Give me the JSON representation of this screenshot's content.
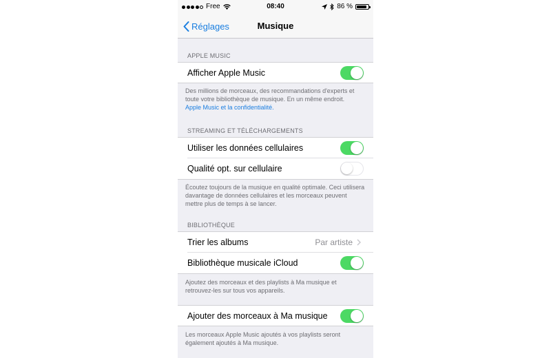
{
  "status_bar": {
    "carrier": "Free",
    "time": "08:40",
    "battery_text": "86 %",
    "battery_level": 0.86
  },
  "nav": {
    "back_label": "Réglages",
    "title": "Musique"
  },
  "sections": {
    "apple_music": {
      "header": "APPLE MUSIC",
      "row_label": "Afficher Apple Music",
      "footer_text": "Des millions de morceaux, des recommandations d'experts et toute votre bibliothèque de musique. En un même endroit.",
      "footer_link": "Apple Music et la confidentialité."
    },
    "streaming": {
      "header": "STREAMING ET TÉLÉCHARGEMENTS",
      "row1_label": "Utiliser les données cellulaires",
      "row2_label": "Qualité opt. sur cellulaire",
      "footer_text": "Écoutez toujours de la musique en qualité optimale. Ceci utilisera davantage de données cellulaires et les morceaux peuvent mettre plus de temps à se lancer."
    },
    "library": {
      "header": "BIBLIOTHÈQUE",
      "sort_label": "Trier les albums",
      "sort_value": "Par artiste",
      "icloud_label": "Bibliothèque musicale iCloud",
      "footer_text": "Ajoutez des morceaux et des playlists à Ma musique et retrouvez-les sur tous vos appareils."
    },
    "add_songs": {
      "row_label": "Ajouter des morceaux à Ma musique",
      "footer_text": "Les morceaux Apple Music ajoutés à vos playlists seront également ajoutés à Ma musique."
    }
  },
  "toggles": {
    "show_apple_music": true,
    "cellular_data": true,
    "high_quality_cellular": false,
    "icloud_library": true,
    "add_songs_to_library": true
  },
  "colors": {
    "accent": "#1a7ee0",
    "toggle_on": "#4cd964",
    "background": "#efeff4"
  }
}
